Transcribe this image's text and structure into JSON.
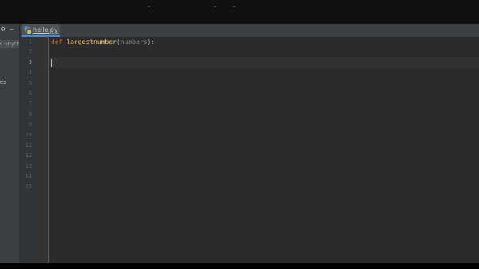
{
  "editor_tab": {
    "label": "hello.py",
    "icon": "python-file-icon"
  },
  "project_panel": {
    "path_fragment": "C:\\Pyth",
    "label_fragment": "es"
  },
  "gutter": {
    "line_numbers": [
      "1",
      "2",
      "3",
      "4",
      "5",
      "6",
      "7",
      "8",
      "9",
      "10",
      "11",
      "12",
      "13",
      "14",
      "15"
    ],
    "current_line": "3"
  },
  "code": {
    "line1": {
      "keyword": "def",
      "function_name": "largestnumber",
      "open_paren": "(",
      "parameter": "numbers",
      "close": "):"
    }
  },
  "colors": {
    "editor_bg": "#2b2b2b",
    "gutter_bg": "#313335",
    "keyword": "#cc7832",
    "function": "#ffc66d",
    "tab_accent": "#4a88c7"
  }
}
